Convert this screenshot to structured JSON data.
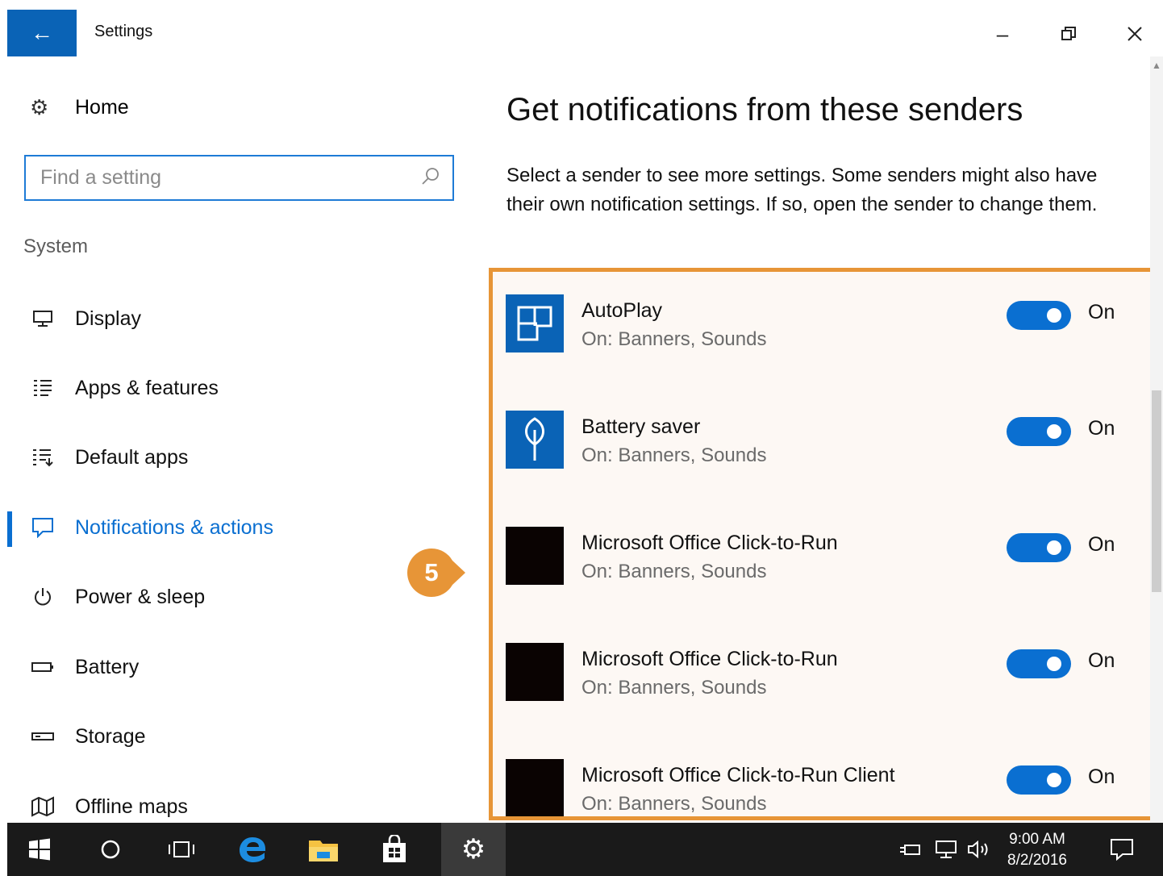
{
  "window": {
    "title": "Settings",
    "back_icon": "arrow-left-icon",
    "controls": [
      "minimize-icon",
      "restore-icon",
      "close-icon"
    ]
  },
  "sidebar": {
    "home_label": "Home",
    "search_placeholder": "Find a setting",
    "group_title": "System",
    "items": [
      {
        "label": "Display",
        "icon": "display-icon",
        "active": false
      },
      {
        "label": "Apps & features",
        "icon": "apps-list-icon",
        "active": false
      },
      {
        "label": "Default apps",
        "icon": "default-apps-icon",
        "active": false
      },
      {
        "label": "Notifications & actions",
        "icon": "notification-icon",
        "active": true
      },
      {
        "label": "Power & sleep",
        "icon": "power-icon",
        "active": false
      },
      {
        "label": "Battery",
        "icon": "battery-icon",
        "active": false
      },
      {
        "label": "Storage",
        "icon": "storage-icon",
        "active": false
      },
      {
        "label": "Offline maps",
        "icon": "map-icon",
        "active": false
      }
    ]
  },
  "main": {
    "heading": "Get notifications from these senders",
    "description": "Select a sender to see more settings. Some senders might also have their own notification settings. If so, open the sender to change them.",
    "senders": [
      {
        "name": "AutoPlay",
        "sub": "On: Banners, Sounds",
        "toggle": "On",
        "icon": "autoplay-icon"
      },
      {
        "name": "Battery saver",
        "sub": "On: Banners, Sounds",
        "toggle": "On",
        "icon": "battery-saver-icon"
      },
      {
        "name": "Microsoft Office Click-to-Run",
        "sub": "On: Banners, Sounds",
        "toggle": "On",
        "icon": "office-app-icon"
      },
      {
        "name": "Microsoft Office Click-to-Run",
        "sub": "On: Banners, Sounds",
        "toggle": "On",
        "icon": "office-app-icon"
      },
      {
        "name": "Microsoft Office Click-to-Run Client",
        "sub": "On: Banners, Sounds",
        "toggle": "On",
        "icon": "office-app-icon"
      }
    ]
  },
  "callout": {
    "number": "5",
    "color": "#e79537"
  },
  "taskbar": {
    "icons": [
      "windows-start-icon",
      "cortana-icon",
      "task-view-icon",
      "edge-icon",
      "file-explorer-icon",
      "store-icon",
      "settings-gear-icon"
    ],
    "tray_icons": [
      "power-plug-icon",
      "network-icon",
      "volume-icon"
    ],
    "time": "9:00 AM",
    "date": "8/2/2016",
    "action_center_icon": "action-center-icon"
  },
  "colors": {
    "accent": "#0a6fd1",
    "highlight": "#e79537"
  }
}
